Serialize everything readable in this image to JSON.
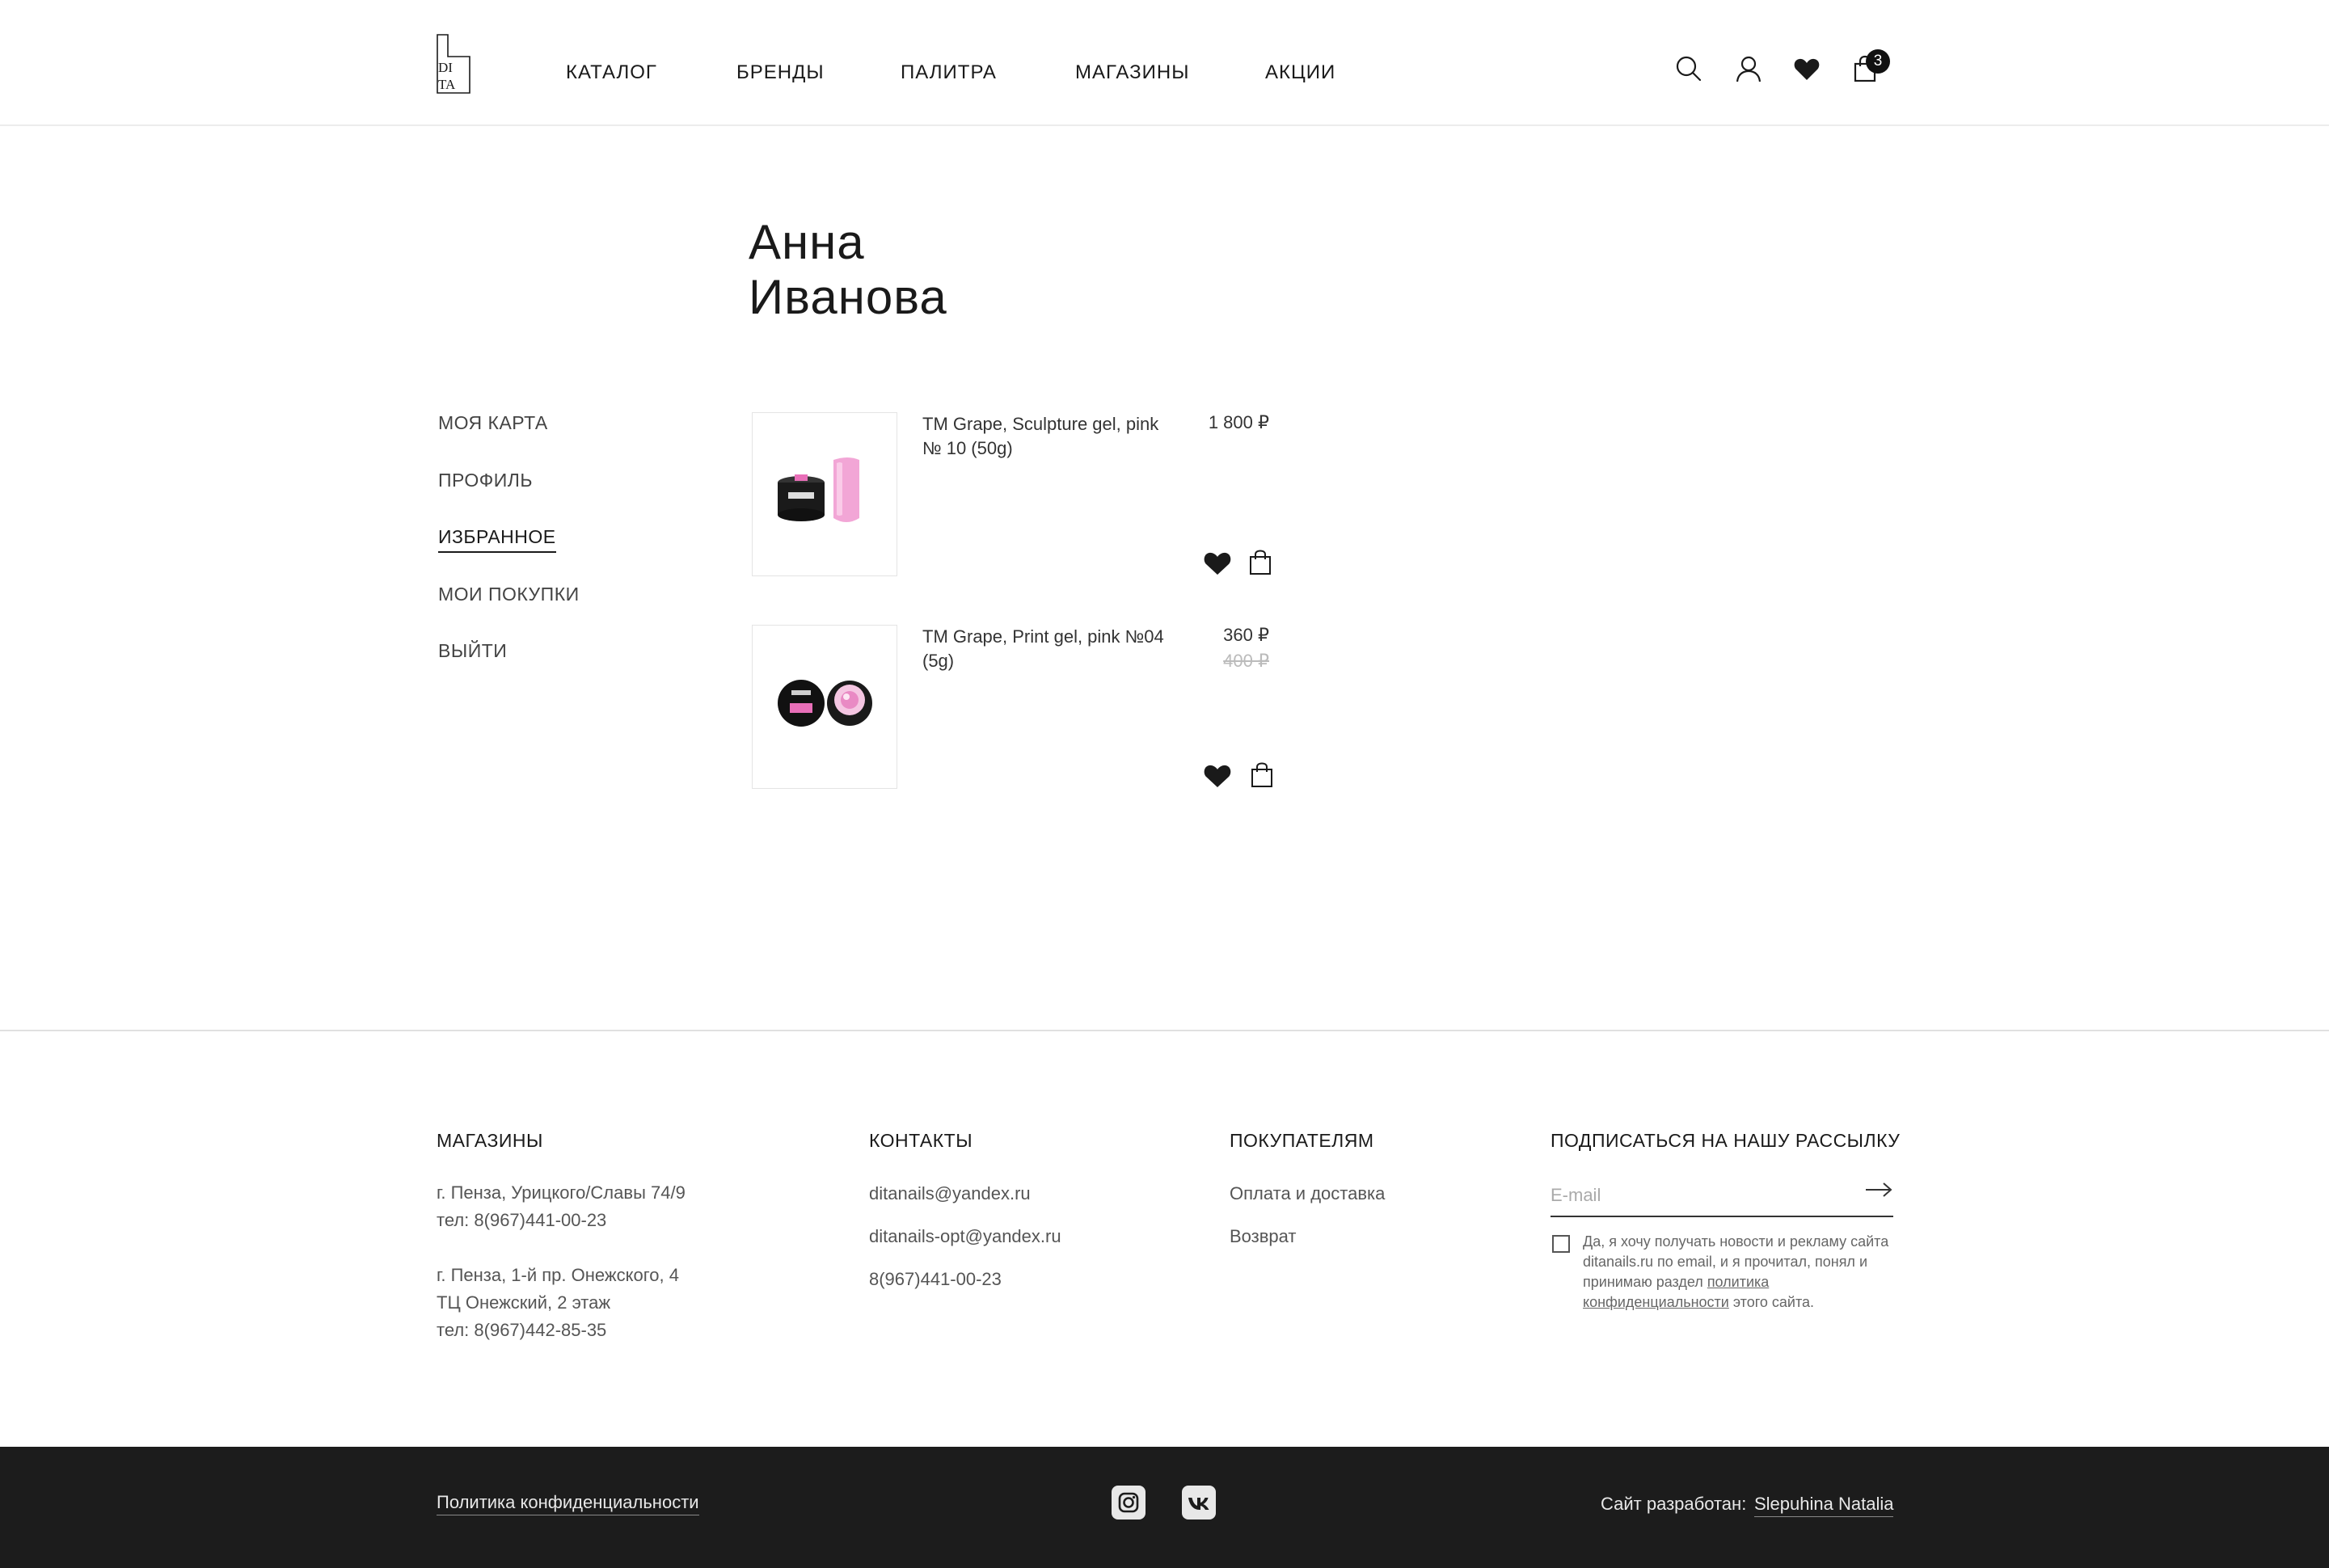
{
  "header": {
    "nav": [
      "КАТАЛОГ",
      "БРЕНДЫ",
      "ПАЛИТРА",
      "МАГАЗИНЫ",
      "АКЦИИ"
    ],
    "cart_count": "3",
    "icons": [
      "search-icon",
      "user-icon",
      "heart-icon",
      "bag-icon"
    ]
  },
  "profile": {
    "first_name": "Анна",
    "last_name": "Иванова"
  },
  "sidebar": {
    "items": [
      {
        "label": "МОЯ КАРТА",
        "active": false
      },
      {
        "label": "ПРОФИЛЬ",
        "active": false
      },
      {
        "label": "ИЗБРАННОЕ",
        "active": true
      },
      {
        "label": "МОИ ПОКУПКИ",
        "active": false
      },
      {
        "label": "ВЫЙТИ",
        "active": false
      }
    ]
  },
  "favorites": [
    {
      "title": "TM Grape, Sculpture gel, pink № 10 (50g)",
      "price": "1 800 ₽",
      "old_price": ""
    },
    {
      "title": "TM Grape, Print gel, pink №04 (5g)",
      "price": "360 ₽",
      "old_price": "400 ₽"
    }
  ],
  "footer": {
    "stores": {
      "heading": "МАГАЗИНЫ",
      "lines": [
        "г. Пенза, Урицкого/Славы 74/9",
        "тел: 8(967)441-00-23",
        "г. Пенза, 1-й пр. Онежского, 4",
        "ТЦ Онежский, 2 этаж",
        "тел: 8(967)442-85-35"
      ]
    },
    "contacts": {
      "heading": "КОНТАКТЫ",
      "items": [
        "ditanails@yandex.ru",
        "ditanails-opt@yandex.ru",
        "8(967)441-00-23"
      ]
    },
    "customers": {
      "heading": "ПОКУПАТЕЛЯМ",
      "items": [
        "Оплата и доставка",
        "Возврат"
      ]
    },
    "newsletter": {
      "heading": "ПОДПИСАТЬСЯ НА НАШУ РАССЫЛКУ",
      "placeholder": "E-mail",
      "consent_text": "Да, я хочу получать новости и рекламу сайта ditanails.ru по email, и я прочитал, понял и принимаю раздел",
      "consent_link": "политика конфиденциальности",
      "consent_tail": "этого сайта."
    }
  },
  "bottom": {
    "privacy": "Политика конфиденциальности",
    "dev_label": "Сайт разработан:",
    "dev_name": "Slepuhina Natalia",
    "socials": [
      "instagram-icon",
      "vk-icon"
    ]
  },
  "colors": {
    "text": "#1a1a1a",
    "footer_bg": "#1c1c1c",
    "accent_pink": "#f2a6d6"
  }
}
